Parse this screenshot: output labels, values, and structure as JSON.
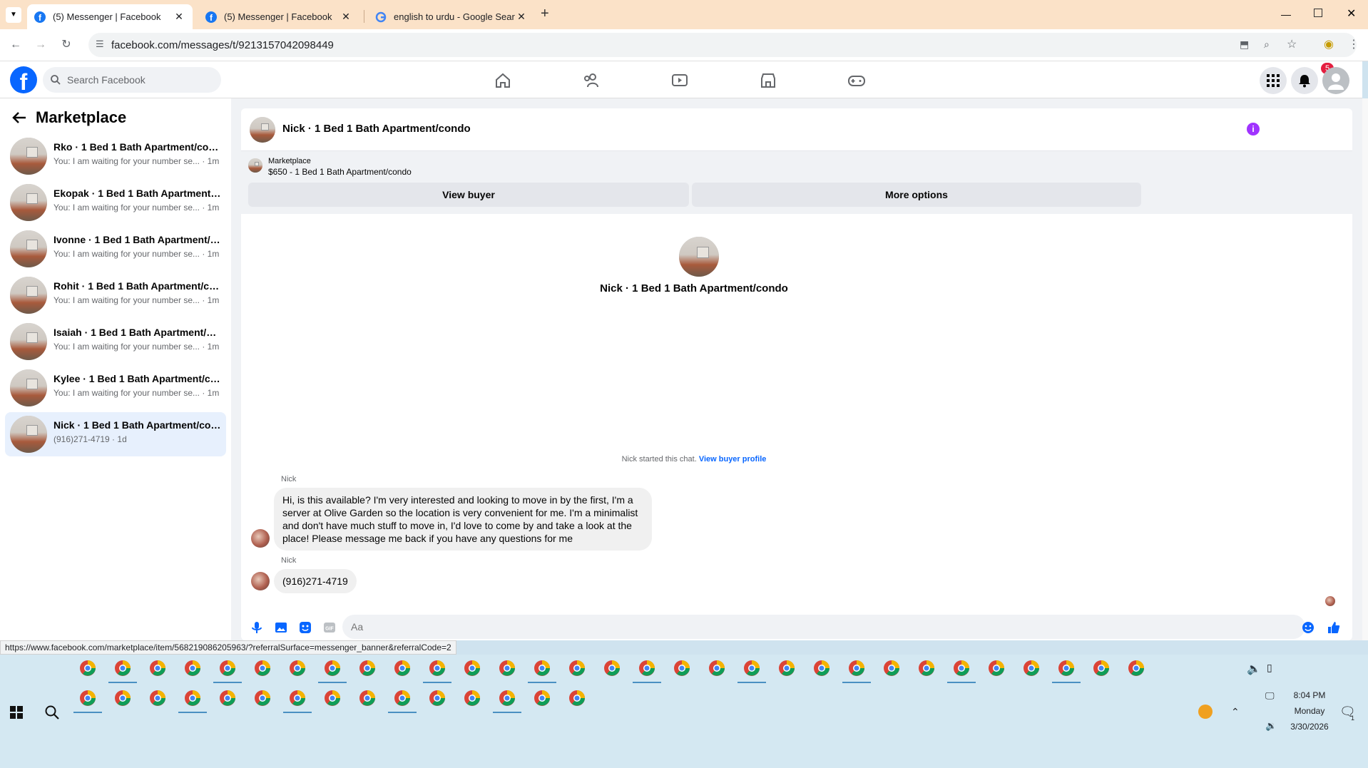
{
  "browser": {
    "tabs": [
      {
        "title": "(5) Messenger | Facebook",
        "icon": "facebook-icon",
        "active": true
      },
      {
        "title": "(5) Messenger | Facebook",
        "icon": "facebook-icon",
        "active": false
      },
      {
        "title": "english to urdu - Google Search",
        "icon": "google-icon",
        "active": false
      }
    ],
    "new_tab": "+",
    "url": "facebook.com/messages/t/9213157042098449",
    "status_url": "https://www.facebook.com/marketplace/item/568219086205963/?referralSurface=messenger_banner&referralCode=2"
  },
  "fb_header": {
    "search_placeholder": "Search Facebook",
    "notification_count": "5",
    "brand_color": "#0866ff"
  },
  "sidebar": {
    "title": "Marketplace",
    "conversations": [
      {
        "name": "Rko · 1 Bed 1 Bath Apartment/condo",
        "preview": "You: I am waiting for your number se... · 1m",
        "selected": false
      },
      {
        "name": "Ekopak · 1 Bed 1 Bath Apartment/c...",
        "preview": "You: I am waiting for your number se... · 1m",
        "selected": false
      },
      {
        "name": "Ivonne · 1 Bed 1 Bath Apartment/c...",
        "preview": "You: I am waiting for your number se... · 1m",
        "selected": false
      },
      {
        "name": "Rohit · 1 Bed 1 Bath Apartment/co...",
        "preview": "You: I am waiting for your number se... · 1m",
        "selected": false
      },
      {
        "name": "Isaiah · 1 Bed 1 Bath Apartment/co...",
        "preview": "You: I am waiting for your number se... · 1m",
        "selected": false
      },
      {
        "name": "Kylee · 1 Bed 1 Bath Apartment/co...",
        "preview": "You: I am waiting for your number se... · 1m",
        "selected": false
      },
      {
        "name": "Nick · 1 Bed 1 Bath Apartment/con...",
        "preview": "(916)271-4719 · 1d",
        "selected": true
      }
    ]
  },
  "chat": {
    "title": "Nick · 1 Bed 1 Bath Apartment/condo",
    "banner_label": "Marketplace",
    "banner_item": "$650 - 1 Bed 1 Bath Apartment/condo",
    "view_buyer": "View buyer",
    "more_options": "More options",
    "profile_name": "Nick · 1 Bed 1 Bath Apartment/condo",
    "started_text": "Nick started this chat.",
    "view_buyer_profile": "View buyer profile",
    "messages": [
      {
        "sender": "Nick",
        "text": "Hi, is this available? I'm very interested and looking to move in by the first, I'm a server at Olive Garden so the location is very convenient for me. I'm a minimalist and don't have much stuff to move in, I'd love to come by and take a look at the place! Please message me back if you have any questions for me"
      },
      {
        "sender": "Nick",
        "text": "(916)271-4719"
      }
    ],
    "input_placeholder": "Aa",
    "accent_color": "#0866ff",
    "info_color": "#a033ff"
  },
  "taskbar": {
    "time": "8:04 PM",
    "day": "Monday",
    "date": "3/30/2026",
    "notification_count": "1"
  }
}
